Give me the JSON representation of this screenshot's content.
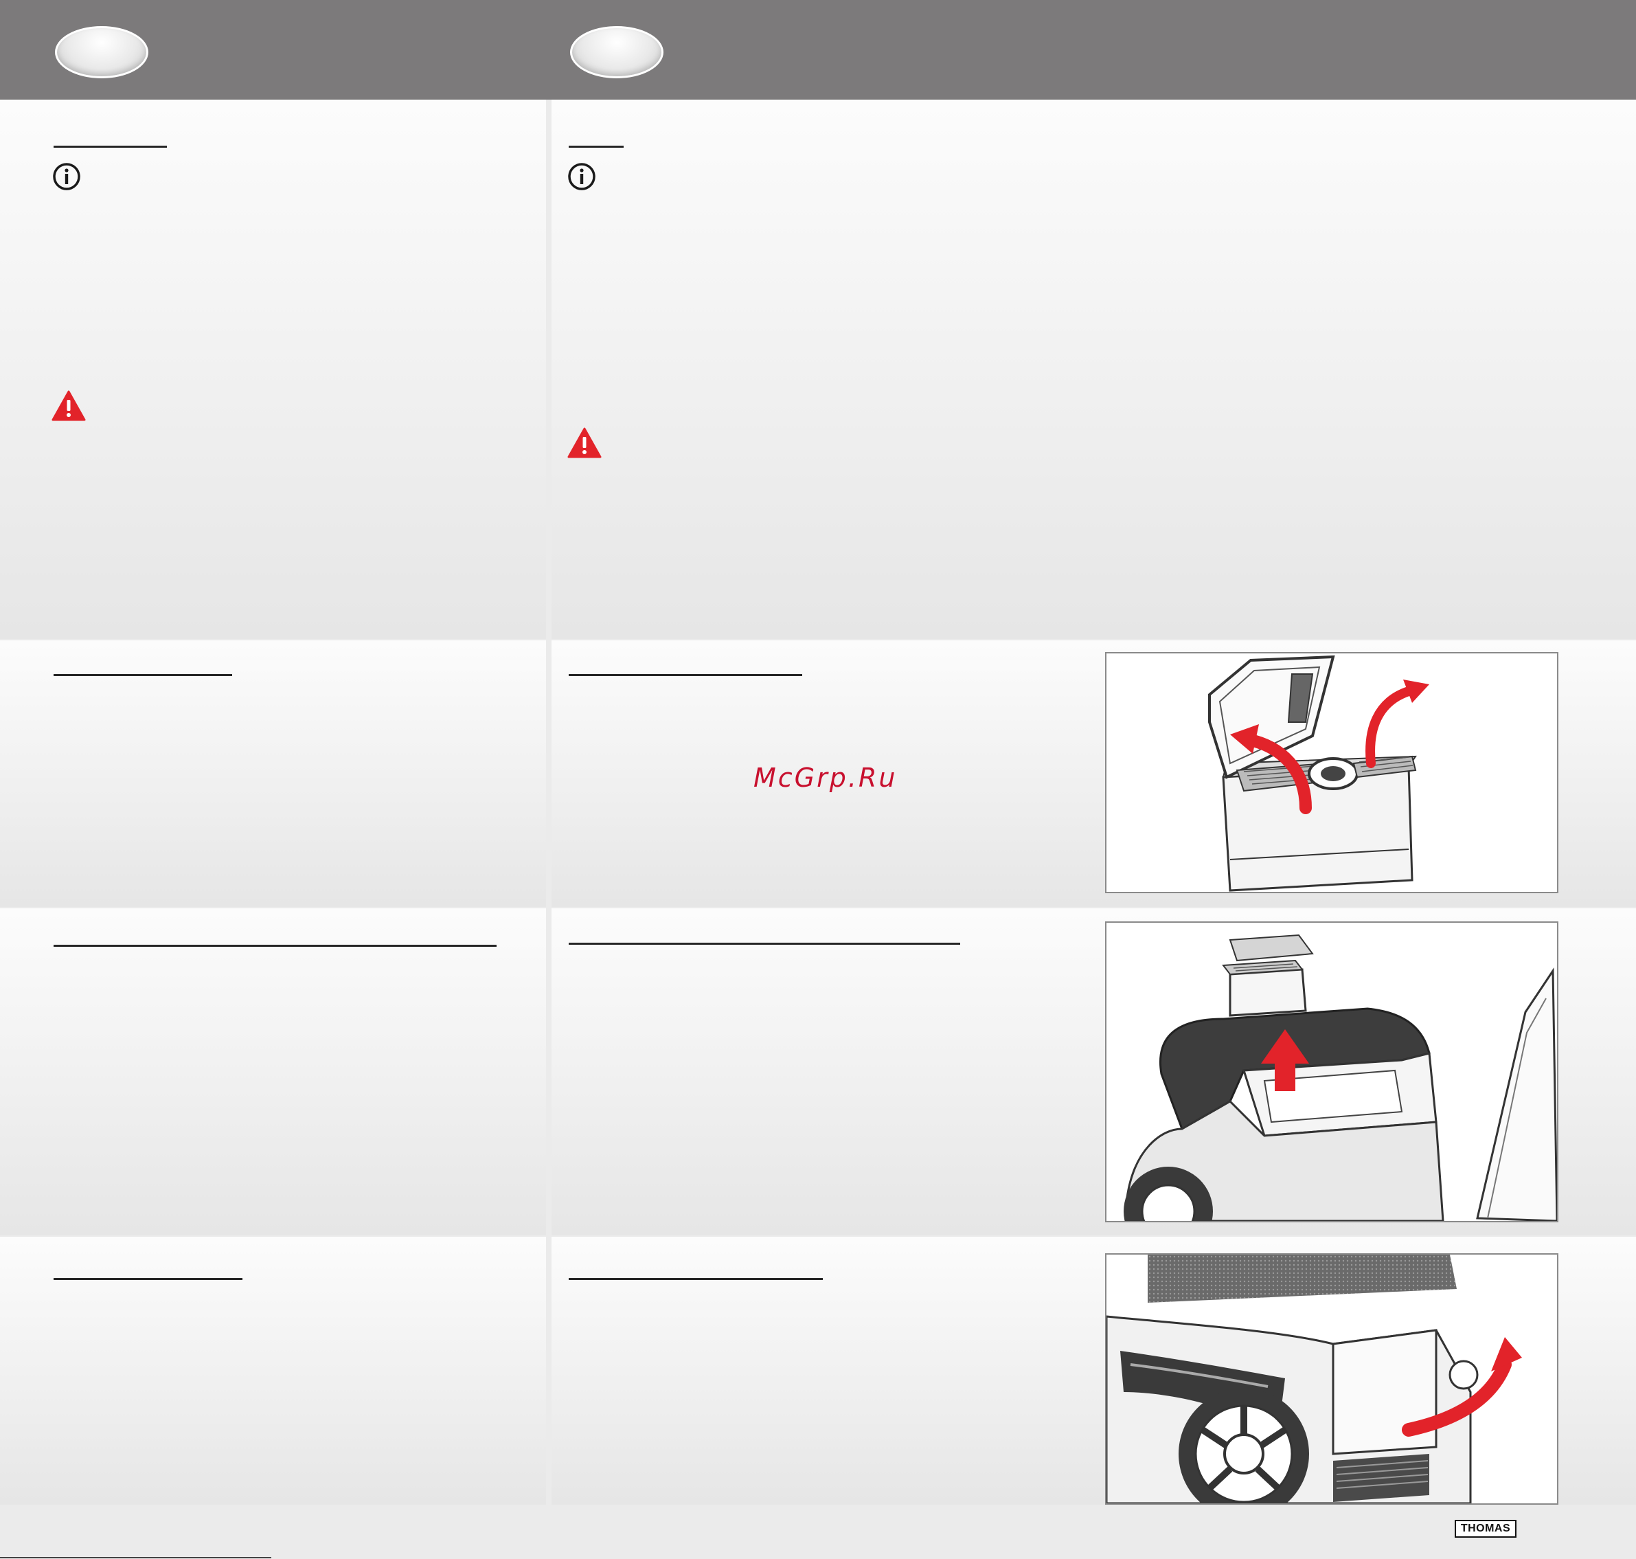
{
  "watermark": {
    "text": "McGrp.Ru"
  },
  "brand": {
    "logo_text": "THOMAS"
  },
  "icons": {
    "info": "info-circle-icon",
    "warning": "warning-triangle-icon",
    "arrow": "red-arrow-icon"
  },
  "colors": {
    "header_bar": "#7c7a7b",
    "warning_red": "#e2232a",
    "arrow_red": "#e2232a",
    "rule": "#262626"
  }
}
